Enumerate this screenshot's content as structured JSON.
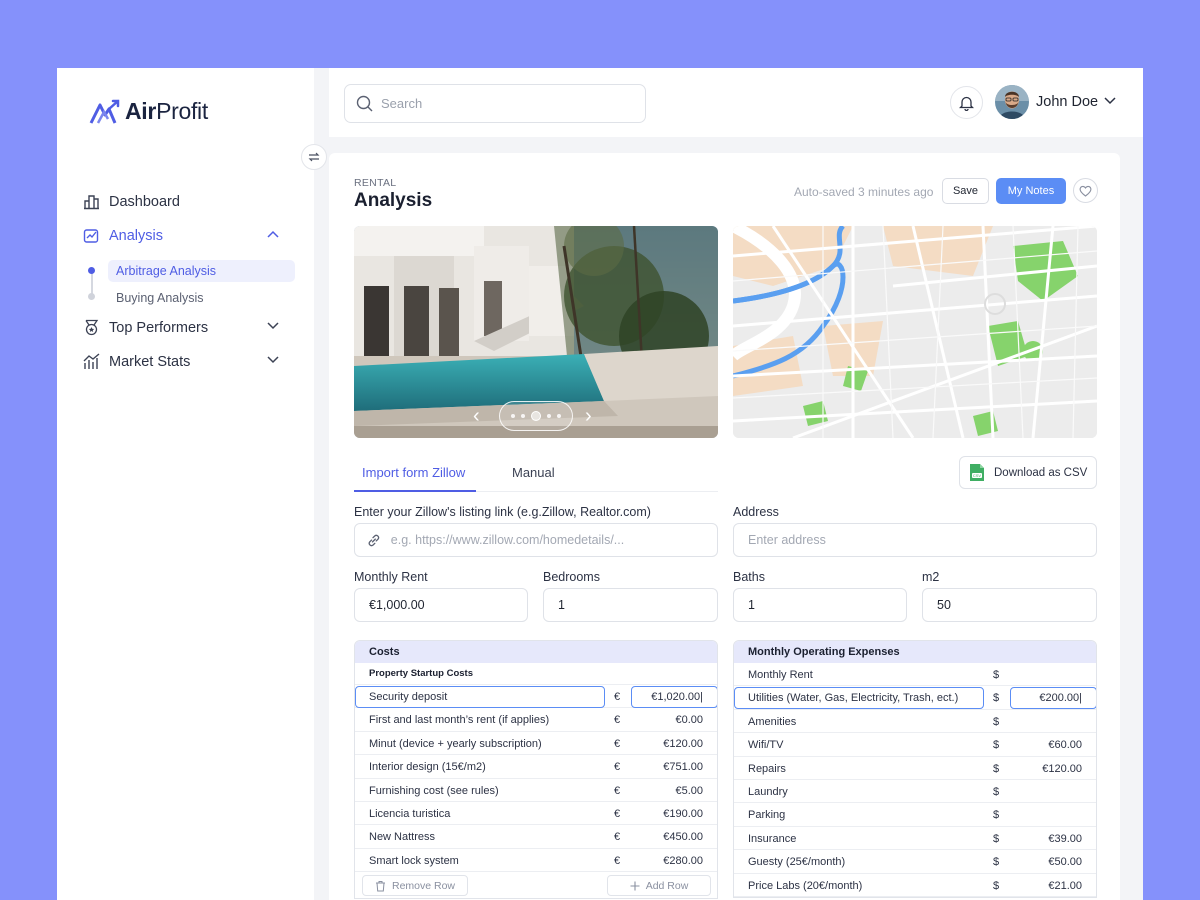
{
  "brand": {
    "name_bold": "Air",
    "name_regular": "Profit",
    "accent": "#4f5de4"
  },
  "sidebar": {
    "items": [
      {
        "label": "Dashboard",
        "icon": "bar-chart-icon"
      },
      {
        "label": "Analysis",
        "icon": "analysis-icon"
      },
      {
        "label": "Top Performers",
        "icon": "medal-icon"
      },
      {
        "label": "Market Stats",
        "icon": "market-stats-icon"
      }
    ],
    "sub_items": [
      {
        "label": "Arbitrage Analysis"
      },
      {
        "label": "Buying Analysis"
      }
    ]
  },
  "topbar": {
    "search_placeholder": "Search",
    "user_name": "John Doe"
  },
  "page": {
    "eyebrow": "RENTAL",
    "title": "Analysis",
    "autosave": "Auto-saved 3 minutes ago",
    "save_label": "Save",
    "notes_label": "My Notes"
  },
  "tabs": [
    {
      "label": "Import form Zillow"
    },
    {
      "label": "Manual"
    }
  ],
  "csv_label": "Download as CSV",
  "form": {
    "listing_label": "Enter your Zillow's listing link (e.g.Zillow, Realtor.com)",
    "listing_placeholder": "e.g. https://www.zillow.com/homedetails/...",
    "address_label": "Address",
    "address_placeholder": "Enter address",
    "rent_label": "Monthly Rent",
    "rent_value": "€1,000.00",
    "bedrooms_label": "Bedrooms",
    "bedrooms_value": "1",
    "baths_label": "Baths",
    "baths_value": "1",
    "m2_label": "m2",
    "m2_value": "50"
  },
  "costs": {
    "header": "Costs",
    "subheader": "Property Startup Costs",
    "rows": [
      {
        "label": "Security deposit",
        "currency": "€",
        "value": "€1,020.00|"
      },
      {
        "label": "First and last month’s rent (if applies)",
        "currency": "€",
        "value": "€0.00"
      },
      {
        "label": "Minut (device + yearly subscription)",
        "currency": "€",
        "value": "€120.00"
      },
      {
        "label": "Interior design (15€/m2)",
        "currency": "€",
        "value": "€751.00"
      },
      {
        "label": "Furnishing cost (see rules)",
        "currency": "€",
        "value": "€5.00"
      },
      {
        "label": "Licencia turistica",
        "currency": "€",
        "value": "€190.00"
      },
      {
        "label": "New Nattress",
        "currency": "€",
        "value": "€450.00"
      },
      {
        "label": "Smart lock system",
        "currency": "€",
        "value": "€280.00"
      }
    ],
    "remove_label": "Remove Row",
    "add_label": "Add Row"
  },
  "expenses": {
    "header": "Monthly Operating Expenses",
    "rows": [
      {
        "label": "Monthly Rent",
        "currency": "$",
        "value": ""
      },
      {
        "label": "Utilities (Water, Gas, Electricity, Trash, ect.)",
        "currency": "$",
        "value": "€200.00|"
      },
      {
        "label": "Amenities",
        "currency": "$",
        "value": ""
      },
      {
        "label": "Wifi/TV",
        "currency": "$",
        "value": "€60.00"
      },
      {
        "label": "Repairs",
        "currency": "$",
        "value": "€120.00"
      },
      {
        "label": "Laundry",
        "currency": "$",
        "value": ""
      },
      {
        "label": "Parking",
        "currency": "$",
        "value": ""
      },
      {
        "label": "Insurance",
        "currency": "$",
        "value": "€39.00"
      },
      {
        "label": "Guesty (25€/month)",
        "currency": "$",
        "value": "€50.00"
      },
      {
        "label": "Price Labs (20€/month)",
        "currency": "$",
        "value": "€21.00"
      }
    ]
  }
}
